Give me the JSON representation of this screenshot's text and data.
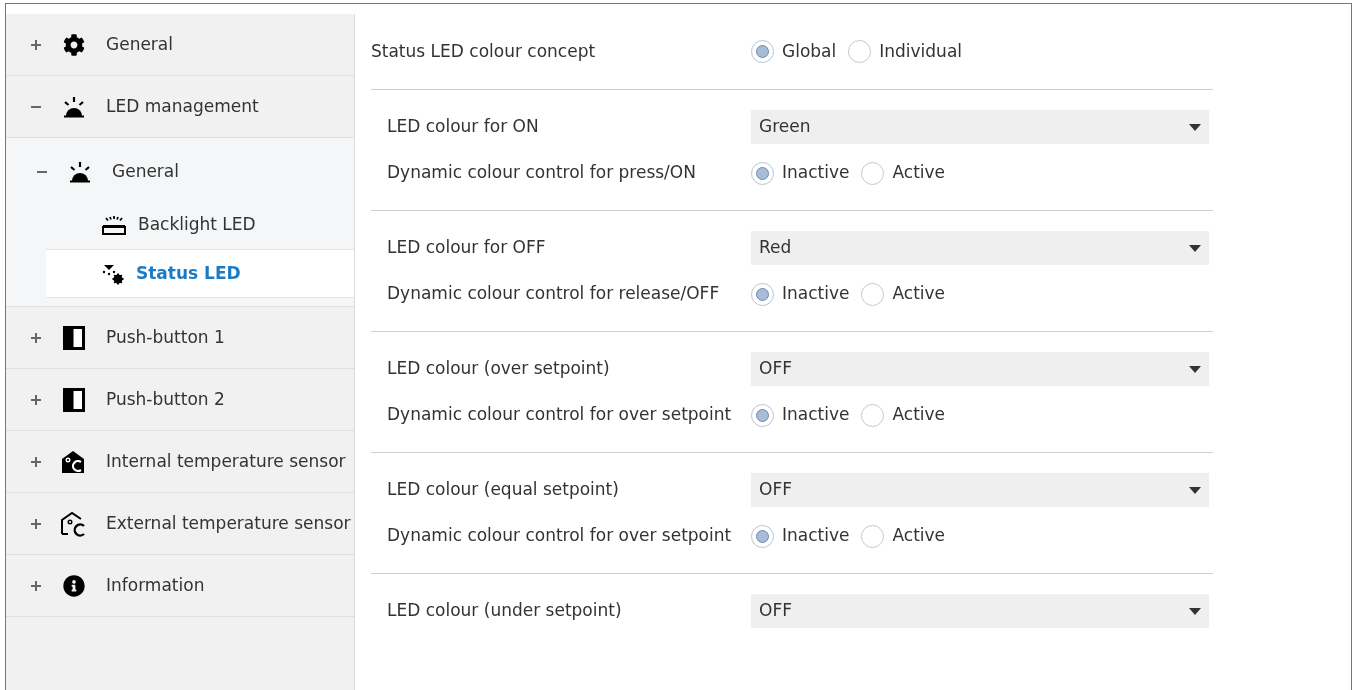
{
  "sidebar": {
    "items": [
      {
        "label": "General",
        "expanded": false,
        "selected": false
      },
      {
        "label": "LED management",
        "expanded": true,
        "selected": false,
        "children": [
          {
            "label": "General",
            "expanded": true,
            "selected": false,
            "children": [
              {
                "label": "Backlight LED",
                "selected": false
              },
              {
                "label": "Status LED",
                "selected": true
              }
            ]
          }
        ]
      },
      {
        "label": "Push-button 1",
        "expanded": false,
        "selected": false
      },
      {
        "label": "Push-button 2",
        "expanded": false,
        "selected": false
      },
      {
        "label": "Internal temperature sensor",
        "expanded": false,
        "selected": false
      },
      {
        "label": "External temperature sensor",
        "expanded": false,
        "selected": false
      },
      {
        "label": "Information",
        "expanded": false,
        "selected": false
      }
    ]
  },
  "concept": {
    "label": "Status LED colour concept",
    "options": [
      {
        "label": "Global",
        "selected": true
      },
      {
        "label": "Individual",
        "selected": false
      }
    ]
  },
  "groups": [
    {
      "rows": [
        {
          "kind": "dropdown",
          "label": "LED colour for ON",
          "value": "Green"
        },
        {
          "kind": "radio",
          "label": "Dynamic colour control for press/ON",
          "options": [
            {
              "label": "Inactive",
              "selected": true
            },
            {
              "label": "Active",
              "selected": false
            }
          ]
        }
      ]
    },
    {
      "rows": [
        {
          "kind": "dropdown",
          "label": "LED colour for OFF",
          "value": "Red"
        },
        {
          "kind": "radio",
          "label": "Dynamic colour control for release/OFF",
          "options": [
            {
              "label": "Inactive",
              "selected": true
            },
            {
              "label": "Active",
              "selected": false
            }
          ]
        }
      ]
    },
    {
      "rows": [
        {
          "kind": "dropdown",
          "label": "LED colour (over setpoint)",
          "value": "OFF"
        },
        {
          "kind": "radio",
          "label": "Dynamic colour control for over setpoint",
          "options": [
            {
              "label": "Inactive",
              "selected": true
            },
            {
              "label": "Active",
              "selected": false
            }
          ]
        }
      ]
    },
    {
      "rows": [
        {
          "kind": "dropdown",
          "label": "LED colour (equal setpoint)",
          "value": "OFF"
        },
        {
          "kind": "radio",
          "label": "Dynamic colour control for over setpoint",
          "options": [
            {
              "label": "Inactive",
              "selected": true
            },
            {
              "label": "Active",
              "selected": false
            }
          ]
        }
      ]
    },
    {
      "rows": [
        {
          "kind": "dropdown",
          "label": "LED colour (under setpoint)",
          "value": "OFF"
        }
      ]
    }
  ]
}
